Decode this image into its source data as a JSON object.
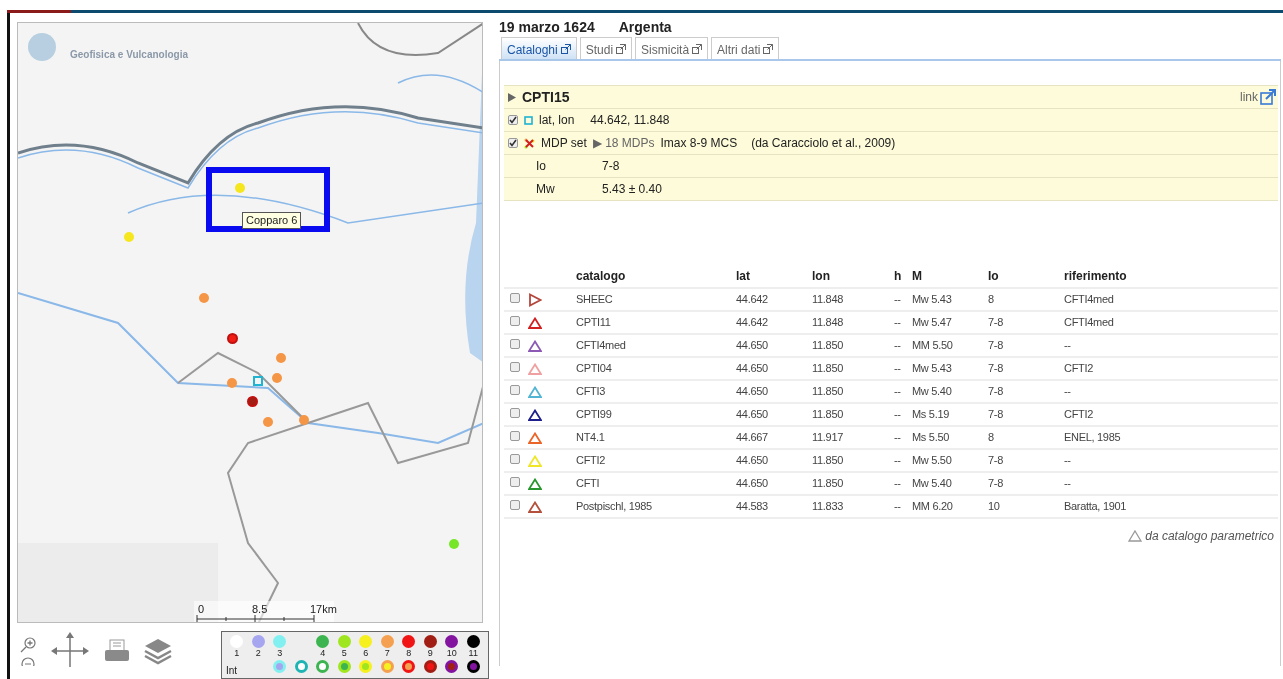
{
  "map": {
    "logo_text": "Geofisica e Vulcanologia",
    "tooltip": "Copparo 6",
    "markers": [
      {
        "kind": "dot",
        "color": "#f5e61e"
      },
      {
        "kind": "dot",
        "color": "#f5e61e"
      },
      {
        "kind": "dot",
        "color": "#f59646"
      },
      {
        "kind": "ring",
        "color": "#f01e14"
      },
      {
        "kind": "dot",
        "color": "#f59646"
      },
      {
        "kind": "dot",
        "color": "#f59646"
      },
      {
        "kind": "dot",
        "color": "#f59646"
      },
      {
        "kind": "square",
        "color": "#1eb4d2"
      },
      {
        "kind": "ring",
        "color": "#a01e14"
      },
      {
        "kind": "dot",
        "color": "#f59646"
      },
      {
        "kind": "dot",
        "color": "#f59646"
      },
      {
        "kind": "dot",
        "color": "#78e628"
      }
    ],
    "scale": [
      "0",
      "8.5",
      "17km"
    ],
    "legend": {
      "label": "Int",
      "levels": [
        {
          "label": "1",
          "color": "#ffffff"
        },
        {
          "label": "2",
          "color": "#a6a6f0"
        },
        {
          "label": "3",
          "color": "#82f0f0"
        },
        {
          "label": "4",
          "color": "#3cb450"
        },
        {
          "label": "5",
          "color": "#a0e61e"
        },
        {
          "label": "6",
          "color": "#f5f01e"
        },
        {
          "label": "7",
          "color": "#f5a050"
        },
        {
          "label": "8",
          "color": "#f01414"
        },
        {
          "label": "9",
          "color": "#a01e14"
        },
        {
          "label": "10",
          "color": "#8214a0"
        },
        {
          "label": "11",
          "color": "#000000"
        }
      ],
      "rings": [
        {
          "color": "#a6a6f0",
          "ring": {
            "color": "#82f0f0"
          }
        },
        {
          "color": "#ffffff",
          "ring": {
            "color": "#1eb4b4"
          }
        },
        {
          "color": "#ffffff",
          "ring": {
            "color": "#3cb450"
          }
        },
        {
          "color": "#3cb450",
          "ring": {
            "color": "#a0e61e"
          }
        },
        {
          "color": "#a0e61e",
          "ring": {
            "color": "#f5f01e"
          }
        },
        {
          "color": "#f5f01e",
          "ring": {
            "color": "#f5a050"
          }
        },
        {
          "color": "#f5a050",
          "ring": {
            "color": "#f01414"
          }
        },
        {
          "color": "#f01414",
          "ring": {
            "color": "#a01e14"
          }
        },
        {
          "color": "#a01e14",
          "ring": {
            "color": "#8214a0"
          }
        },
        {
          "color": "#8214a0",
          "ring": {
            "color": "#000000"
          }
        }
      ]
    }
  },
  "event": {
    "date": "19 marzo 1624",
    "place": "Argenta"
  },
  "tabs": [
    {
      "label": "Cataloghi",
      "selected": true
    },
    {
      "label": "Studi",
      "selected": false
    },
    {
      "label": "Sismicità",
      "selected": false
    },
    {
      "label": "Altri dati",
      "selected": false
    }
  ],
  "catalog": {
    "name": "CPTI15",
    "link": "link",
    "rows": [
      {
        "kind": "location",
        "checked": true,
        "label": "lat, lon",
        "value": "44.642, 11.848"
      },
      {
        "kind": "mdp",
        "checked": true,
        "label": "MDP set",
        "mdps": "▶ 18 MDPs",
        "imax": "Imax 8-9 MCS",
        "source": "(da Caracciolo et al., 2009)"
      },
      {
        "kind": "plain",
        "label": "Io",
        "value": "7-8"
      },
      {
        "kind": "plain",
        "label": "Mw",
        "value": "5.43 ± 0.40"
      }
    ]
  },
  "table": {
    "columns": [
      "catalogo",
      "lat",
      "lon",
      "h",
      "M",
      "Io",
      "riferimento"
    ],
    "rows": [
      {
        "checked": false,
        "kind": "right",
        "color": "#b4463c",
        "cells": [
          "SHEEC",
          "44.642",
          "11.848",
          "--",
          "Mw 5.43",
          "8",
          "CFTI4med"
        ]
      },
      {
        "checked": false,
        "kind": "up",
        "color": "#d21e1e",
        "cells": [
          "CPTI11",
          "44.642",
          "11.848",
          "--",
          "Mw 5.47",
          "7-8",
          "CFTI4med"
        ]
      },
      {
        "checked": false,
        "kind": "up",
        "color": "#8c5ab4",
        "cells": [
          "CFTI4med",
          "44.650",
          "11.850",
          "--",
          "MM 5.50",
          "7-8",
          "--"
        ]
      },
      {
        "checked": false,
        "kind": "up",
        "color": "#f0a0a0",
        "cells": [
          "CPTI04",
          "44.650",
          "11.850",
          "--",
          "Mw 5.43",
          "7-8",
          "CFTI2"
        ]
      },
      {
        "checked": false,
        "kind": "up",
        "color": "#50b4d2",
        "cells": [
          "CFTI3",
          "44.650",
          "11.850",
          "--",
          "Mw 5.40",
          "7-8",
          "--"
        ]
      },
      {
        "checked": false,
        "kind": "up",
        "color": "#1e1e8c",
        "cells": [
          "CPTI99",
          "44.650",
          "11.850",
          "--",
          "Ms 5.19",
          "7-8",
          "CFTI2"
        ]
      },
      {
        "checked": false,
        "kind": "up",
        "color": "#eb6428",
        "cells": [
          "NT4.1",
          "44.667",
          "11.917",
          "--",
          "Ms 5.50",
          "8",
          "ENEL, 1985"
        ]
      },
      {
        "checked": false,
        "kind": "up",
        "color": "#f0e628",
        "cells": [
          "CFTI2",
          "44.650",
          "11.850",
          "--",
          "Mw 5.50",
          "7-8",
          "--"
        ]
      },
      {
        "checked": false,
        "kind": "up",
        "color": "#28962d",
        "cells": [
          "CFTI",
          "44.650",
          "11.850",
          "--",
          "Mw 5.40",
          "7-8",
          "--"
        ]
      },
      {
        "checked": false,
        "kind": "up",
        "color": "#b4503c",
        "cells": [
          "Postpischl, 1985",
          "44.583",
          "11.833",
          "--",
          "MM 6.20",
          "10",
          "Baratta, 1901"
        ]
      }
    ]
  },
  "footnote": "da catalogo parametrico"
}
